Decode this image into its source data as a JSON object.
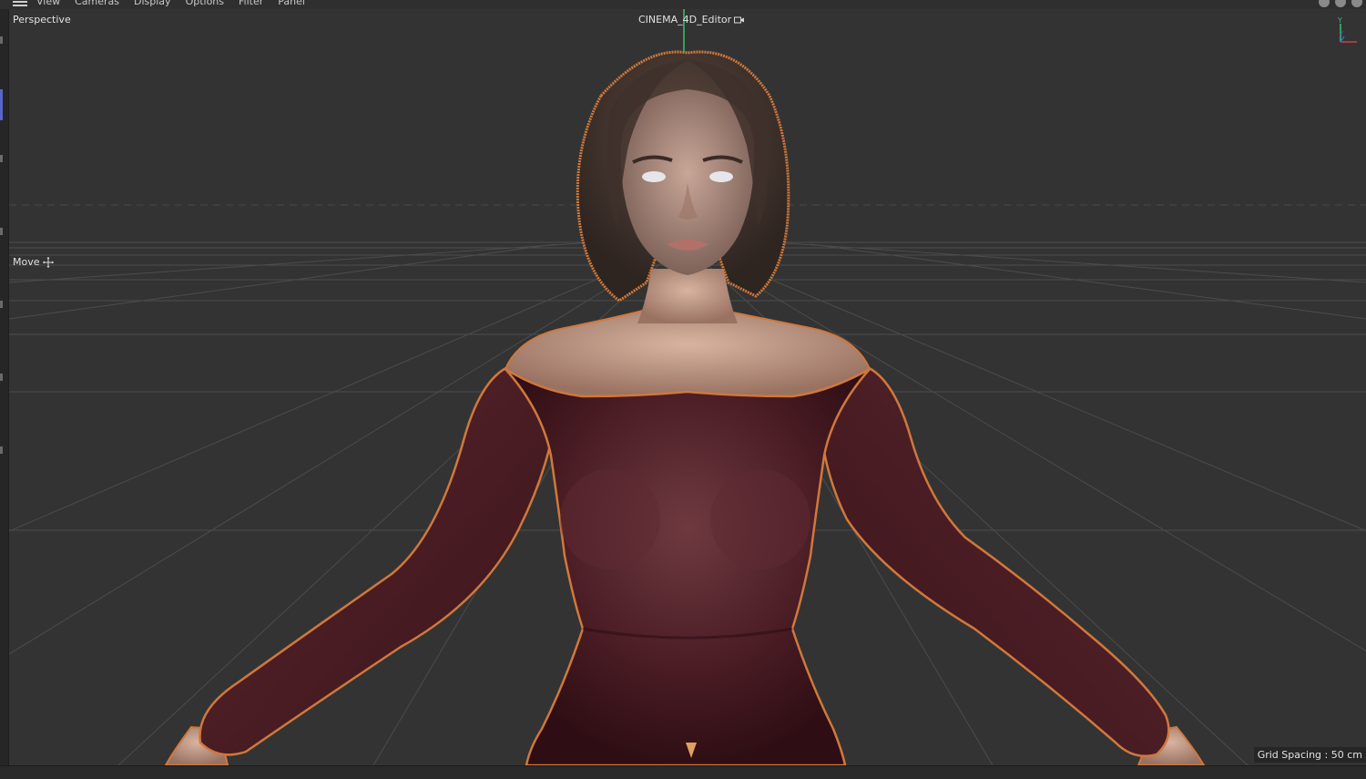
{
  "menubar": {
    "items": [
      "View",
      "Cameras",
      "Display",
      "Options",
      "Filter",
      "Panel"
    ]
  },
  "viewport": {
    "view_name": "Perspective",
    "camera_name": "CINEMA_4D_Editor",
    "active_tool": "Move",
    "grid_spacing": "Grid Spacing : 50 cm"
  },
  "axis_gizmo": {
    "y_label": "Y",
    "z_label": "Z"
  },
  "colors": {
    "viewport_bg": "#333333",
    "grid_line": "#4a4a4a",
    "selection_outline": "#d0783c",
    "dress": "#4a1a22",
    "skin": "#c9a08a",
    "hair": "#4a3a30"
  },
  "icons": {
    "menu": "hamburger-icon",
    "camera": "camera-icon",
    "move": "move-cross-icon"
  }
}
